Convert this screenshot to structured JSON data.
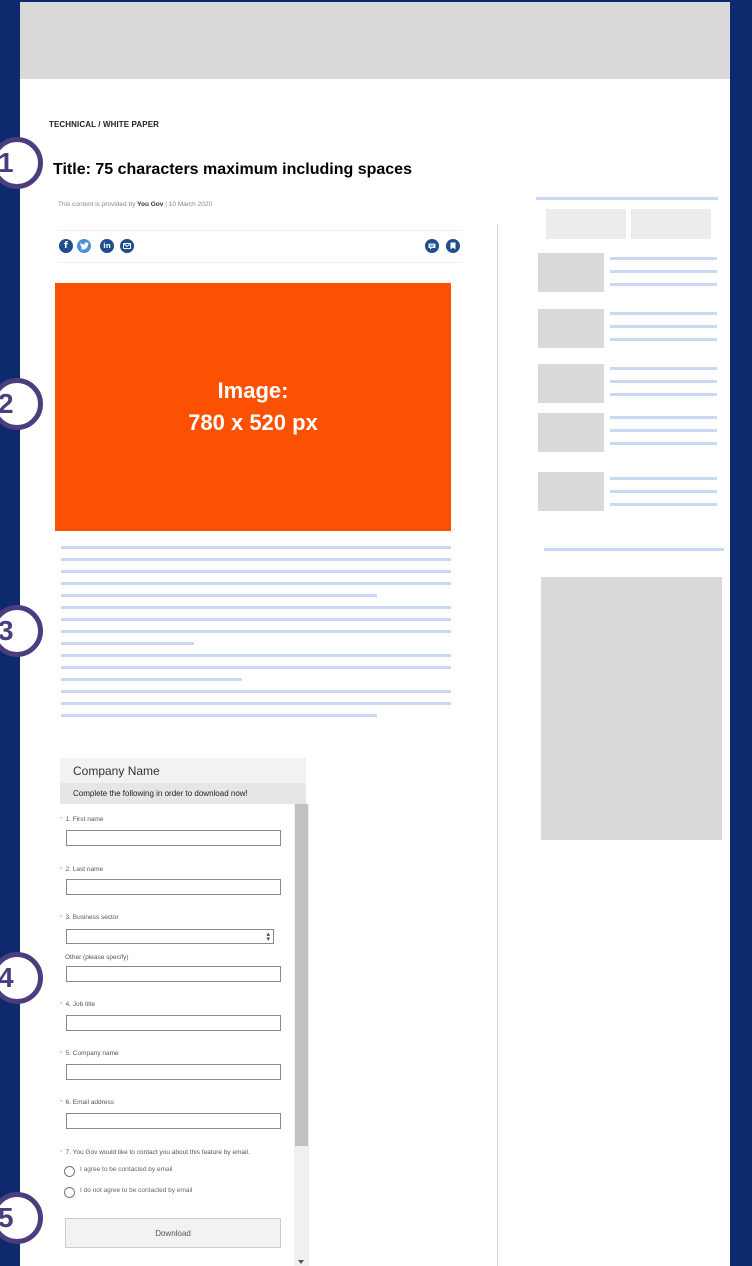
{
  "article": {
    "category": "TECHNICAL / WHITE PAPER",
    "title": "Title: 75 characters maximum including spaces",
    "provided_prefix": "This content is provided by",
    "provider": "You Gov",
    "date_sep": "| 10 March 2020"
  },
  "share": {
    "icons": [
      "facebook-icon",
      "twitter-icon",
      "linkedin-icon",
      "email-icon"
    ],
    "facebook": "f",
    "linkedin": "in",
    "right_icons": [
      "comment-icon",
      "bookmark-icon"
    ]
  },
  "hero": {
    "line1": "Image:",
    "line2": "780 x 520 px",
    "color": "#fc5102"
  },
  "form": {
    "company": "Company Name",
    "instructions": "Complete the following in order to download now!",
    "fields": {
      "first_name": "1. First name",
      "last_name": "2. Last name",
      "business_sector": "3. Business sector",
      "other": "Other (please specify)",
      "job_title": "4. Job title",
      "company_name": "5. Company name",
      "email": "6. Email address",
      "consent_question": "7. You Gov would like to contact you about this feature by email.",
      "consent_yes": "I agree to be contacted by email",
      "consent_no": "I do not agree to be contacted by email"
    },
    "download": "Download"
  },
  "badges": [
    "1",
    "2",
    "3",
    "4",
    "5"
  ],
  "colors": {
    "background": "#0e2a6e",
    "badge": "#4b3d7f",
    "accent_orange": "#fc5102",
    "placeholder_line": "#c9d8f5",
    "placeholder_box": "#d9d9d9",
    "share_icon": "#1f4e8c"
  }
}
